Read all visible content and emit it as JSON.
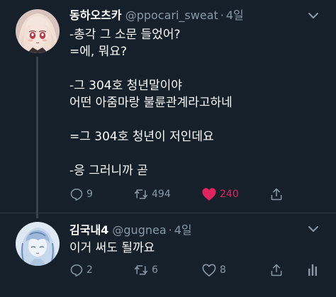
{
  "tweets": [
    {
      "name": "동하오츠카",
      "handle": "@ppocari_sweat",
      "separator": "·",
      "time": "4일",
      "text": "-총각 그 소문 들었어?\n=에, 뭐요?\n\n-그 304호 청년말이야\n어떤 아줌마랑 불륜관계라고하네\n\n=그 304호 청년이 저인데요\n\n-응 그러니까 곧",
      "replies": "9",
      "retweets": "494",
      "likes": "240",
      "liked": true,
      "icons": [
        "reply-icon",
        "retweet-icon",
        "heart-filled-icon",
        "share-icon",
        "more-icon"
      ],
      "avatar": "anime-girl-avatar"
    },
    {
      "name": "김국내4",
      "handle": "@gugnea",
      "separator": "·",
      "time": "4일",
      "text": "이거 써도 될까요",
      "replies": "2",
      "retweets": "6",
      "likes": "8",
      "liked": false,
      "icons": [
        "reply-icon",
        "retweet-icon",
        "heart-icon",
        "share-icon",
        "stats-icon",
        "more-icon"
      ],
      "avatar": "sketch-avatar"
    }
  ],
  "colors": {
    "background": "#15202b",
    "text": "#ffffff",
    "muted": "#8899a6",
    "like": "#e0245e",
    "divider": "#2f3a45"
  }
}
